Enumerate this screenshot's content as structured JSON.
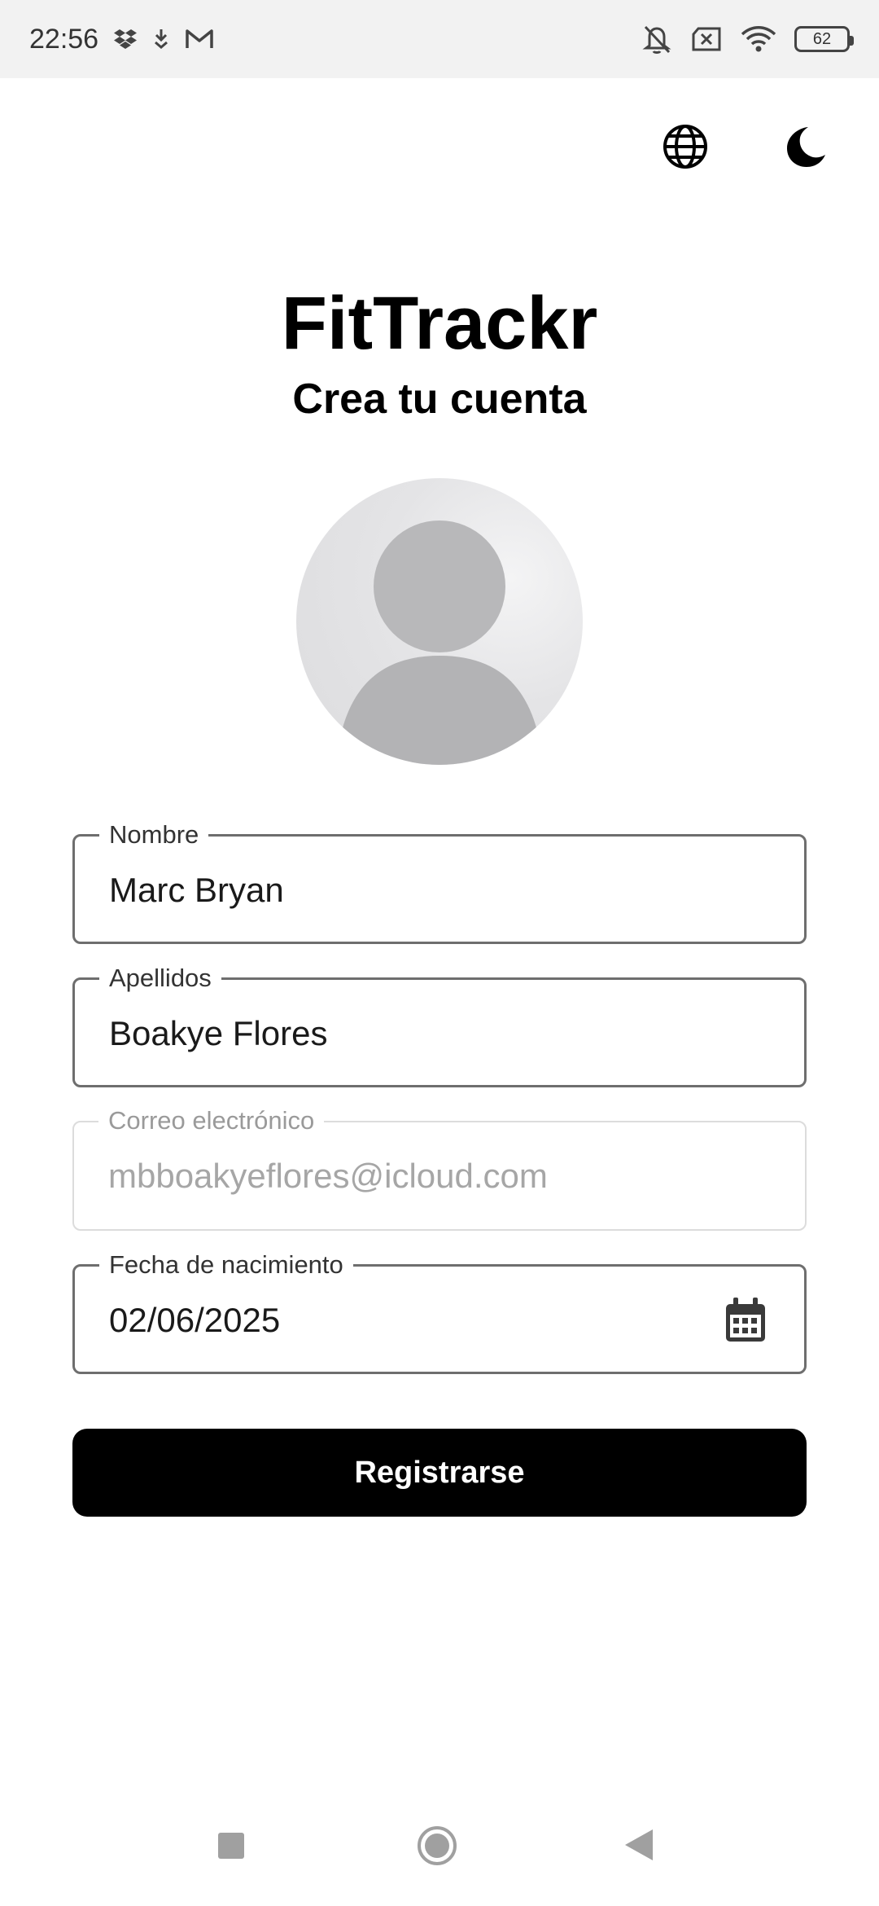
{
  "status_bar": {
    "time": "22:56",
    "battery": "62",
    "left_icons": [
      "dropbox-icon",
      "download-icon",
      "gmail-icon"
    ],
    "right_icons": [
      "bell-off-icon",
      "sim-disabled-icon",
      "wifi-icon",
      "battery-icon"
    ]
  },
  "header": {
    "app_name": "FitTrackr",
    "subtitle": "Crea tu cuenta"
  },
  "top_actions": {
    "language_icon": "globe-icon",
    "theme_icon": "moon-icon"
  },
  "form": {
    "first_name": {
      "label": "Nombre",
      "value": "Marc Bryan"
    },
    "last_name": {
      "label": "Apellidos",
      "value": "Boakye Flores"
    },
    "email": {
      "label": "Correo electrónico",
      "value": "mbboakyeflores@icloud.com"
    },
    "birth_date": {
      "label": "Fecha de nacimiento",
      "value": "02/06/2025"
    }
  },
  "register_button": "Registrarse",
  "nav": [
    "recents",
    "home",
    "back"
  ]
}
